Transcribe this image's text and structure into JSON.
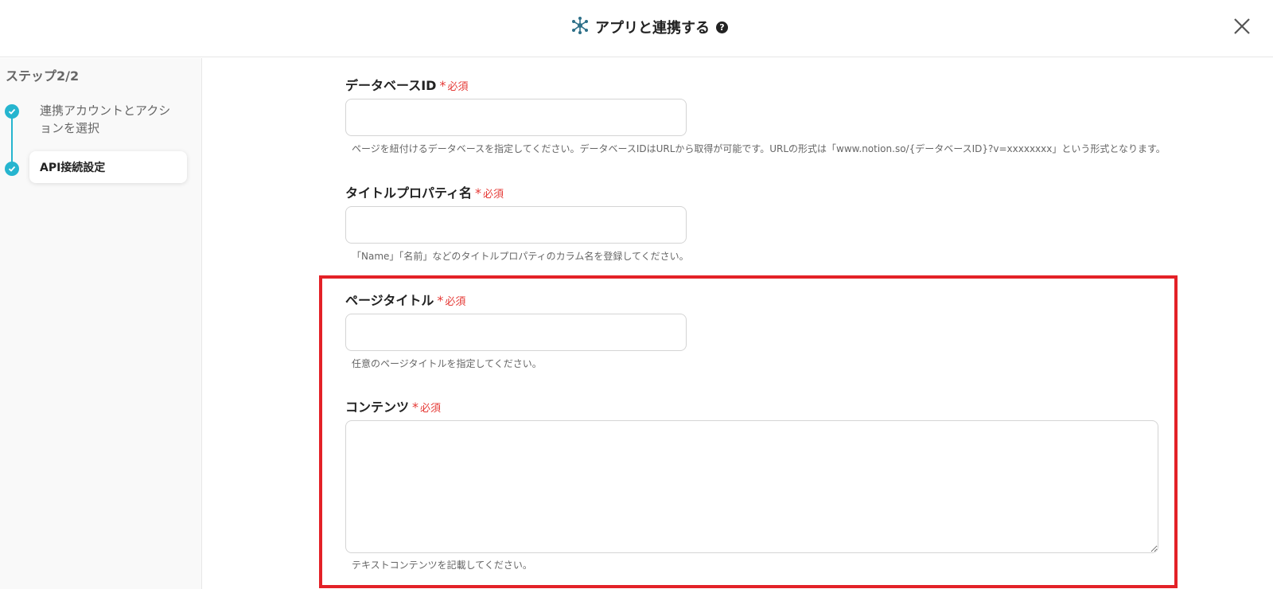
{
  "header": {
    "title": "アプリと連携する",
    "help_icon": "question-icon",
    "close_icon": "close-icon",
    "app_icon": "network-hub-icon"
  },
  "sidebar": {
    "step_indicator": "ステップ2/2",
    "steps": [
      {
        "label": "連携アカウントとアクションを選択",
        "status": "completed"
      },
      {
        "label": "API接続設定",
        "status": "current"
      }
    ]
  },
  "form": {
    "required_label": "必須",
    "fields": [
      {
        "label": "データベースID",
        "value": "",
        "help": "ページを紐付けるデータベースを指定してください。データベースIDはURLから取得が可能です。URLの形式は「www.notion.so/{データベースID}?v=xxxxxxxx」という形式となります。"
      },
      {
        "label": "タイトルプロパティ名",
        "value": "",
        "help": "「Name」「名前」などのタイトルプロパティのカラム名を登録してください。"
      },
      {
        "label": "ページタイトル",
        "value": "",
        "help": "任意のページタイトルを指定してください。"
      },
      {
        "label": "コンテンツ",
        "value": "",
        "help": "テキストコンテンツを記載してください。"
      }
    ]
  },
  "colors": {
    "accent": "#26b5cf",
    "required": "#e53935",
    "highlight": "#e32127"
  }
}
